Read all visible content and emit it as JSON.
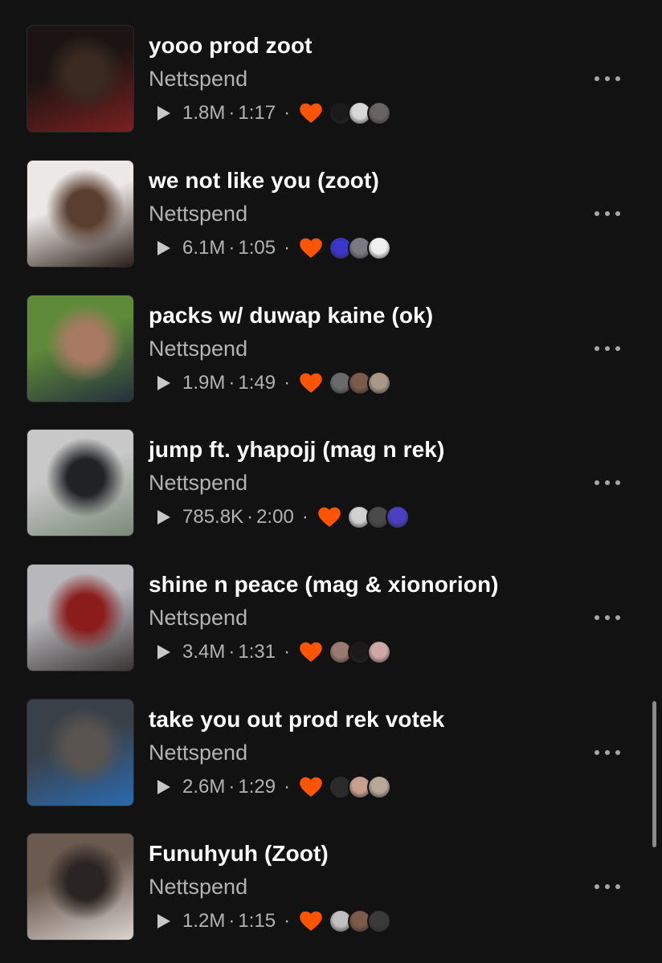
{
  "colors": {
    "background": "#121212",
    "title": "#ffffff",
    "secondary": "#b3b3b3",
    "heart": "#ff5500"
  },
  "tracks": [
    {
      "title": "yooo prod zoot",
      "artist": "Nettspend",
      "plays": "1.8M",
      "duration": "1:17",
      "liked": true,
      "thumb_colors": [
        "#1c1412",
        "#3a2a22",
        "#7a2020"
      ],
      "avatar_colors": [
        "#1a1a1a",
        "#d8d8d8",
        "#6a6460"
      ]
    },
    {
      "title": "we not like you (zoot)",
      "artist": "Nettspend",
      "plays": "6.1M",
      "duration": "1:05",
      "liked": true,
      "thumb_colors": [
        "#ece8e6",
        "#5a3e30",
        "#2a1e18"
      ],
      "avatar_colors": [
        "#3a36c8",
        "#7a7a82",
        "#f0f0f0"
      ]
    },
    {
      "title": "packs w/ duwap kaine (ok)",
      "artist": "Nettspend",
      "plays": "1.9M",
      "duration": "1:49",
      "liked": true,
      "thumb_colors": [
        "#5e8a3a",
        "#a87a62",
        "#24303c"
      ],
      "avatar_colors": [
        "#6a6a6a",
        "#7a5a48",
        "#a89888"
      ]
    },
    {
      "title": "jump ft. yhapojj (mag n rek)",
      "artist": "Nettspend",
      "plays": "785.8K",
      "duration": "2:00",
      "liked": true,
      "thumb_colors": [
        "#c8c8c8",
        "#202226",
        "#7a8a78"
      ],
      "avatar_colors": [
        "#d0d0d0",
        "#4a4a4a",
        "#4840c0"
      ]
    },
    {
      "title": "shine n peace (mag & xionorion)",
      "artist": "Nettspend",
      "plays": "3.4M",
      "duration": "1:31",
      "liked": true,
      "thumb_colors": [
        "#b8b8bc",
        "#8a1c1c",
        "#3a3434"
      ],
      "avatar_colors": [
        "#9a7a70",
        "#1a1a1a",
        "#d0a8a8"
      ]
    },
    {
      "title": "take you out prod rek votek",
      "artist": "Nettspend",
      "plays": "2.6M",
      "duration": "1:29",
      "liked": true,
      "thumb_colors": [
        "#3a4048",
        "#5a5450",
        "#2a6ab0"
      ],
      "avatar_colors": [
        "#2a2a2a",
        "#c8a090",
        "#b8a89a"
      ]
    },
    {
      "title": "Funuhyuh (Zoot)",
      "artist": "Nettspend",
      "plays": "1.2M",
      "duration": "1:15",
      "liked": true,
      "thumb_colors": [
        "#6a5a50",
        "#2a2422",
        "#dcd4d0"
      ],
      "avatar_colors": [
        "#c0c0c0",
        "#7a5a48",
        "#3a3a3a"
      ]
    }
  ]
}
